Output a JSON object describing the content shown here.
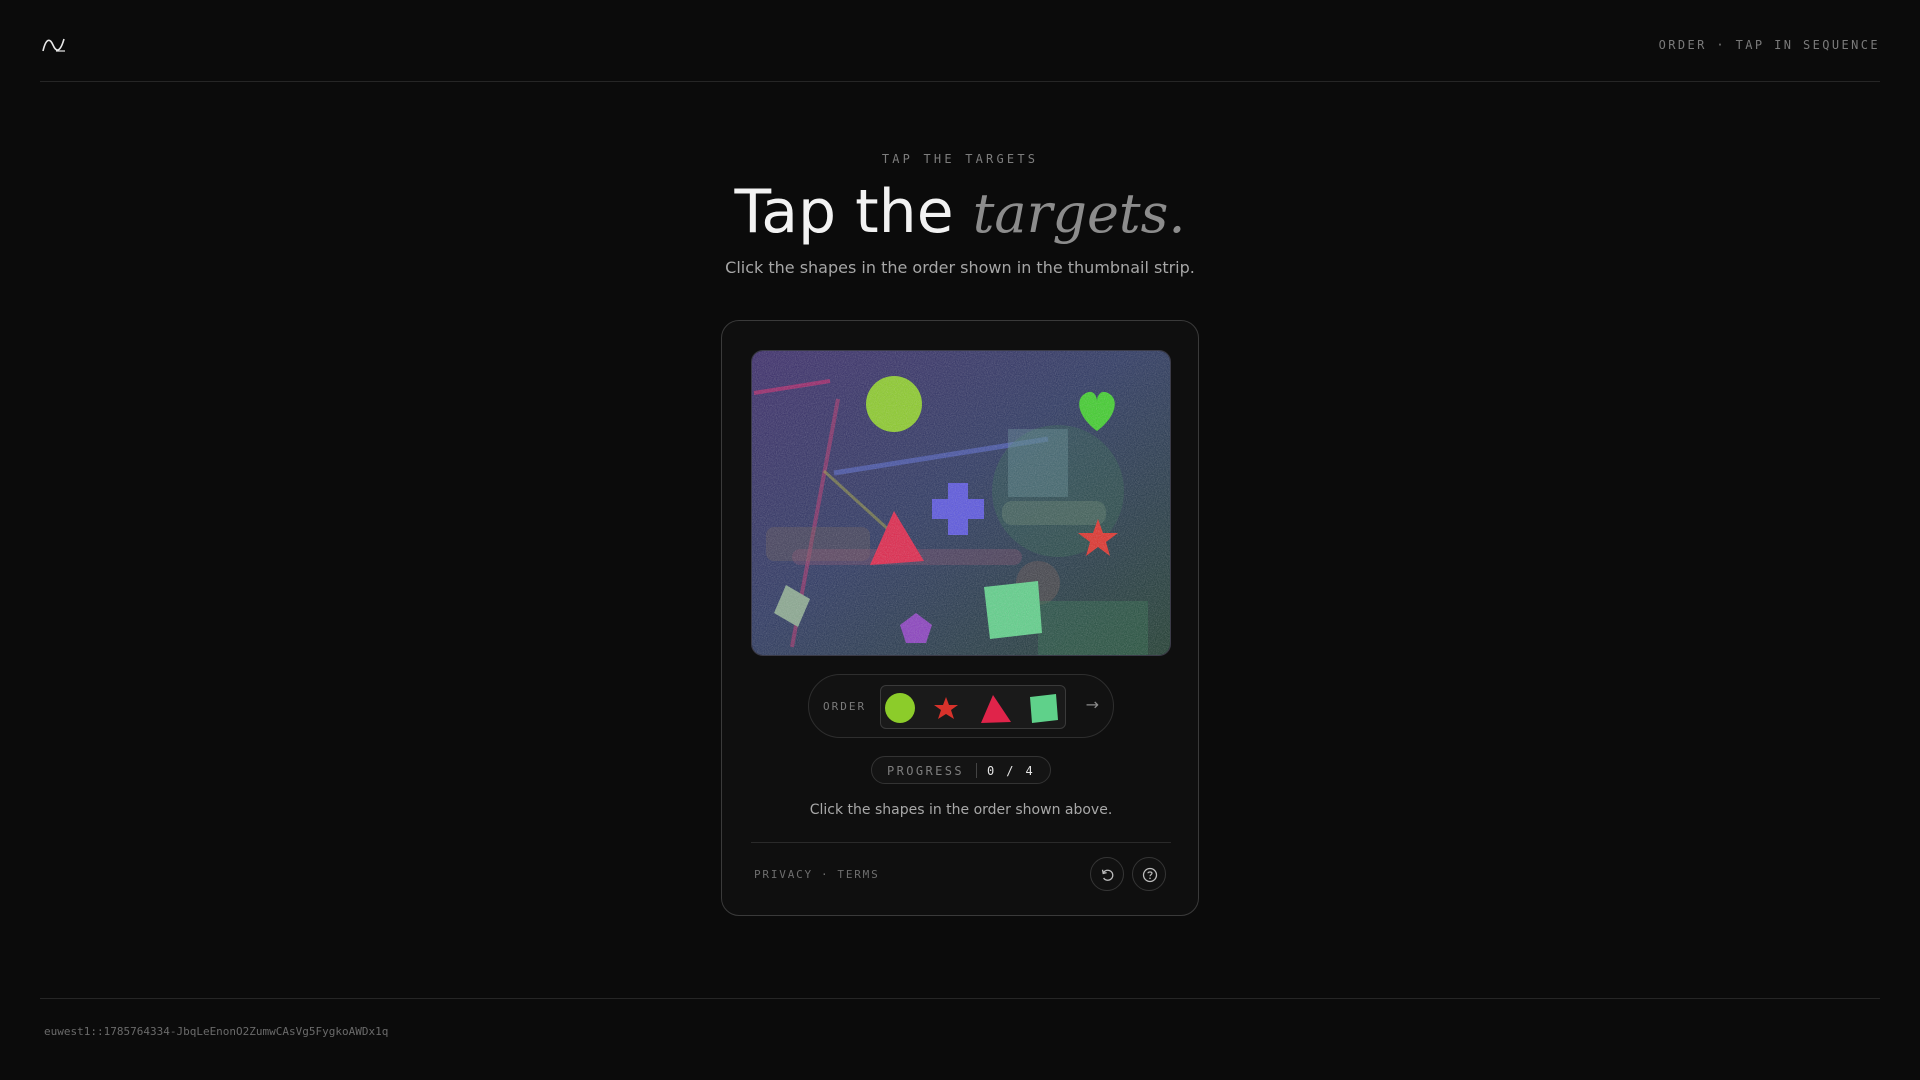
{
  "header": {
    "logo_icon": "wave-logo-icon",
    "right_label": "ORDER · TAP IN SEQUENCE"
  },
  "hero": {
    "eyebrow": "TAP THE TARGETS",
    "title_main": "Tap the ",
    "title_accent": "targets.",
    "subtitle": "Click the shapes in the order shown in the thumbnail strip."
  },
  "challenge": {
    "canvas_shapes": [
      {
        "shape": "circle",
        "color": "#8ccc2a"
      },
      {
        "shape": "heart",
        "color": "#3fcf2b"
      },
      {
        "shape": "cross",
        "color": "#5a55e0"
      },
      {
        "shape": "triangle",
        "color": "#e0244a"
      },
      {
        "shape": "star",
        "color": "#e0302a"
      },
      {
        "shape": "square",
        "color": "#5fd18a"
      },
      {
        "shape": "pentagon",
        "color": "#8a3fc0"
      },
      {
        "shape": "diamond",
        "color": "#8aa890"
      }
    ],
    "order_label": "ORDER",
    "order_sequence": [
      {
        "shape": "circle",
        "color": "#8ccc2a",
        "icon": "circle-thumb-icon"
      },
      {
        "shape": "star",
        "color": "#d8322b",
        "icon": "star-thumb-icon"
      },
      {
        "shape": "triangle",
        "color": "#e0244a",
        "icon": "triangle-thumb-icon"
      },
      {
        "shape": "square",
        "color": "#5fd18a",
        "icon": "square-thumb-icon"
      }
    ],
    "arrow_icon": "arrow-right-icon",
    "progress_label": "PROGRESS",
    "progress_value": "0 / 4",
    "progress_done": 0,
    "progress_total": 4,
    "instruction": "Click the shapes in the order shown above."
  },
  "footer_links": {
    "privacy": "PRIVACY",
    "separator": "·",
    "terms": "TERMS"
  },
  "actions": {
    "refresh_icon": "refresh-icon",
    "help_icon": "help-icon"
  },
  "footer": {
    "session_id": "euwest1::1785764334-JbqLeEnonO2ZumwCAsVg5FygkoAWDx1q"
  }
}
